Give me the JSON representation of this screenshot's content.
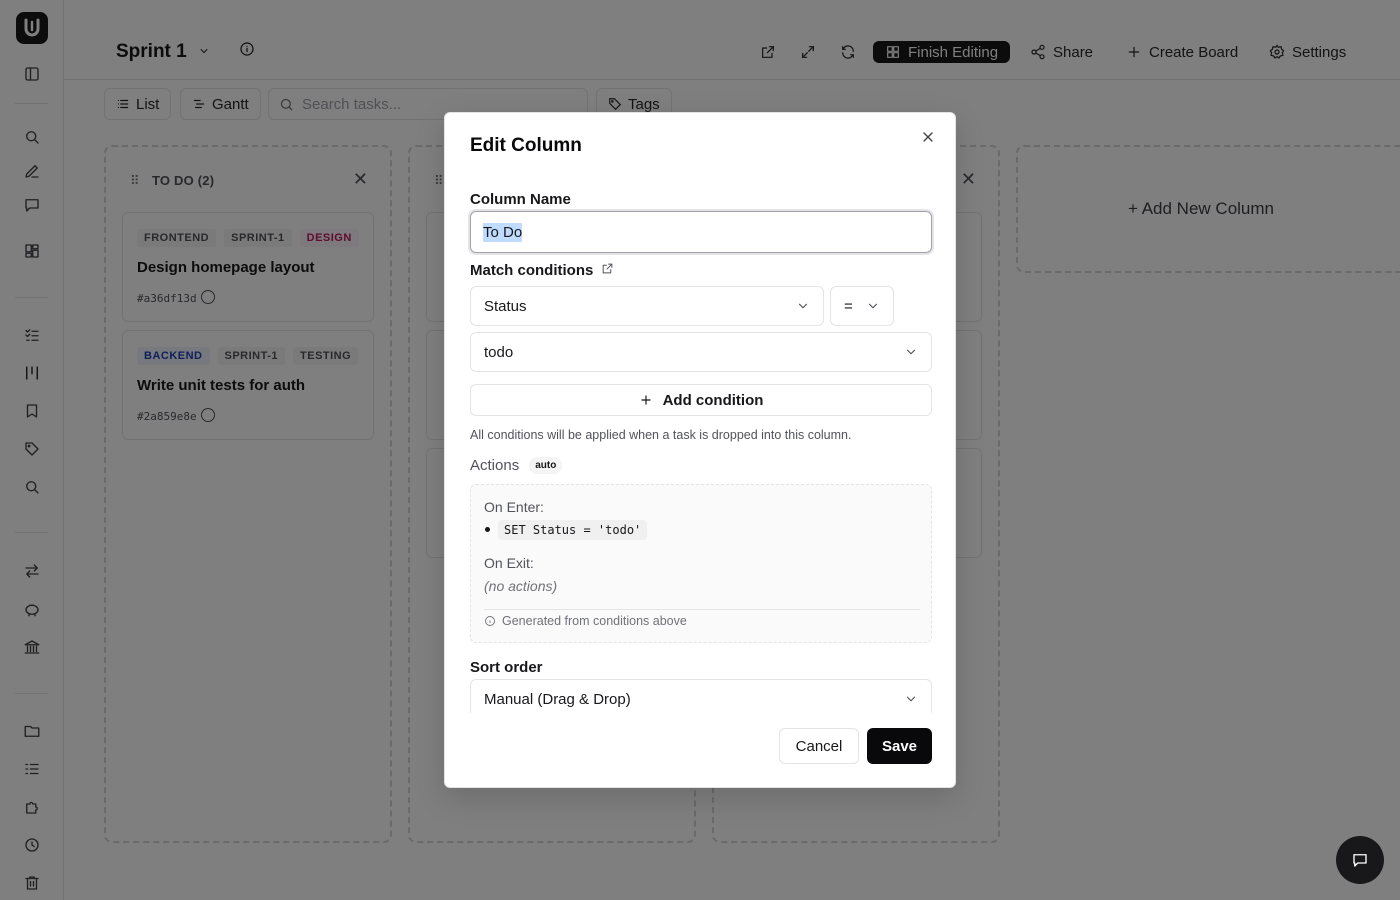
{
  "header": {
    "board_title": "Sprint 1",
    "finish_editing": "Finish Editing",
    "share": "Share",
    "create_board": "Create Board",
    "settings": "Settings"
  },
  "toolbar": {
    "list": "List",
    "gantt": "Gantt",
    "search_placeholder": "Search tasks...",
    "tags": "Tags"
  },
  "board": {
    "columns": [
      {
        "title": "TO DO (2)",
        "cards": [
          {
            "tags": [
              "FRONTEND",
              "SPRINT-1",
              "DESIGN"
            ],
            "title": "Design homepage layout",
            "id": "#a36df13d"
          },
          {
            "tags": [
              "BACKEND",
              "SPRINT-1",
              "TESTING"
            ],
            "title": "Write unit tests for auth",
            "id": "#2a859e8e"
          }
        ]
      }
    ],
    "add_column": "+ Add New Column"
  },
  "modal": {
    "title": "Edit Column",
    "column_name_label": "Column Name",
    "column_name_value": "To Do",
    "match_conditions_label": "Match conditions",
    "condition_field": "Status",
    "condition_operator": "=",
    "condition_value": "todo",
    "add_condition": "Add condition",
    "hint": "All conditions will be applied when a task is dropped into this column.",
    "actions_label": "Actions",
    "actions_badge": "auto",
    "on_enter_label": "On Enter:",
    "on_enter_action": "SET Status = 'todo'",
    "on_exit_label": "On Exit:",
    "on_exit_action": "(no actions)",
    "generated_note": "Generated from conditions above",
    "sort_order_label": "Sort order",
    "sort_order_value": "Manual (Drag & Drop)",
    "cancel": "Cancel",
    "save": "Save"
  },
  "colors": {
    "primary": "#18181b",
    "overlay": "rgba(0,0,0,0.5)",
    "tag_design": "#be185d",
    "tag_backend": "#1e40af"
  }
}
